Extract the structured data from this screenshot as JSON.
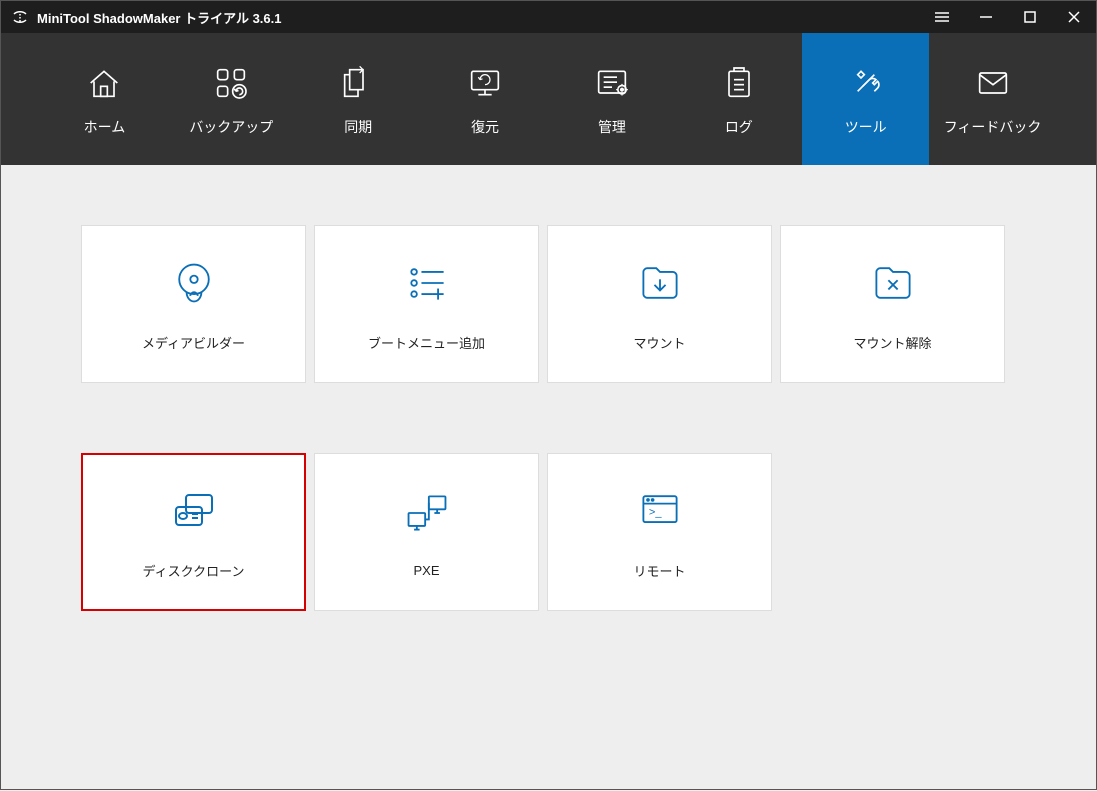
{
  "title": "MiniTool ShadowMaker トライアル 3.6.1",
  "accent": "#0a6fb7",
  "nav": {
    "items": [
      {
        "label": "ホーム"
      },
      {
        "label": "バックアップ"
      },
      {
        "label": "同期"
      },
      {
        "label": "復元"
      },
      {
        "label": "管理"
      },
      {
        "label": "ログ"
      },
      {
        "label": "ツール"
      },
      {
        "label": "フィードバック"
      }
    ],
    "active_index": 6
  },
  "tools": {
    "row1": [
      {
        "label": "メディアビルダー"
      },
      {
        "label": "ブートメニュー追加"
      },
      {
        "label": "マウント"
      },
      {
        "label": "マウント解除"
      }
    ],
    "row2": [
      {
        "label": "ディスククローン",
        "highlighted": true
      },
      {
        "label": "PXE"
      },
      {
        "label": "リモート"
      }
    ]
  }
}
